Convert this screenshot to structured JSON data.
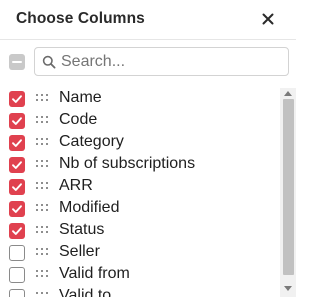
{
  "header": {
    "title": "Choose Columns",
    "close_icon": "close-icon"
  },
  "search": {
    "placeholder": "Search...",
    "value": "",
    "icon": "search-icon"
  },
  "select_all": {
    "state": "indeterminate"
  },
  "columns": [
    {
      "label": "Name",
      "checked": true
    },
    {
      "label": "Code",
      "checked": true
    },
    {
      "label": "Category",
      "checked": true
    },
    {
      "label": "Nb of subscriptions",
      "checked": true
    },
    {
      "label": "ARR",
      "checked": true
    },
    {
      "label": "Modified",
      "checked": true
    },
    {
      "label": "Status",
      "checked": true
    },
    {
      "label": "Seller",
      "checked": false
    },
    {
      "label": "Valid from",
      "checked": false
    },
    {
      "label": "Valid to",
      "checked": false
    }
  ],
  "colors": {
    "checked": "#e0414f",
    "master_indeterminate": "#c9c9c9",
    "scroll_thumb": "#c1c1c1"
  },
  "icons": {
    "drag": "drag-handle-icon",
    "check": "check-icon"
  }
}
